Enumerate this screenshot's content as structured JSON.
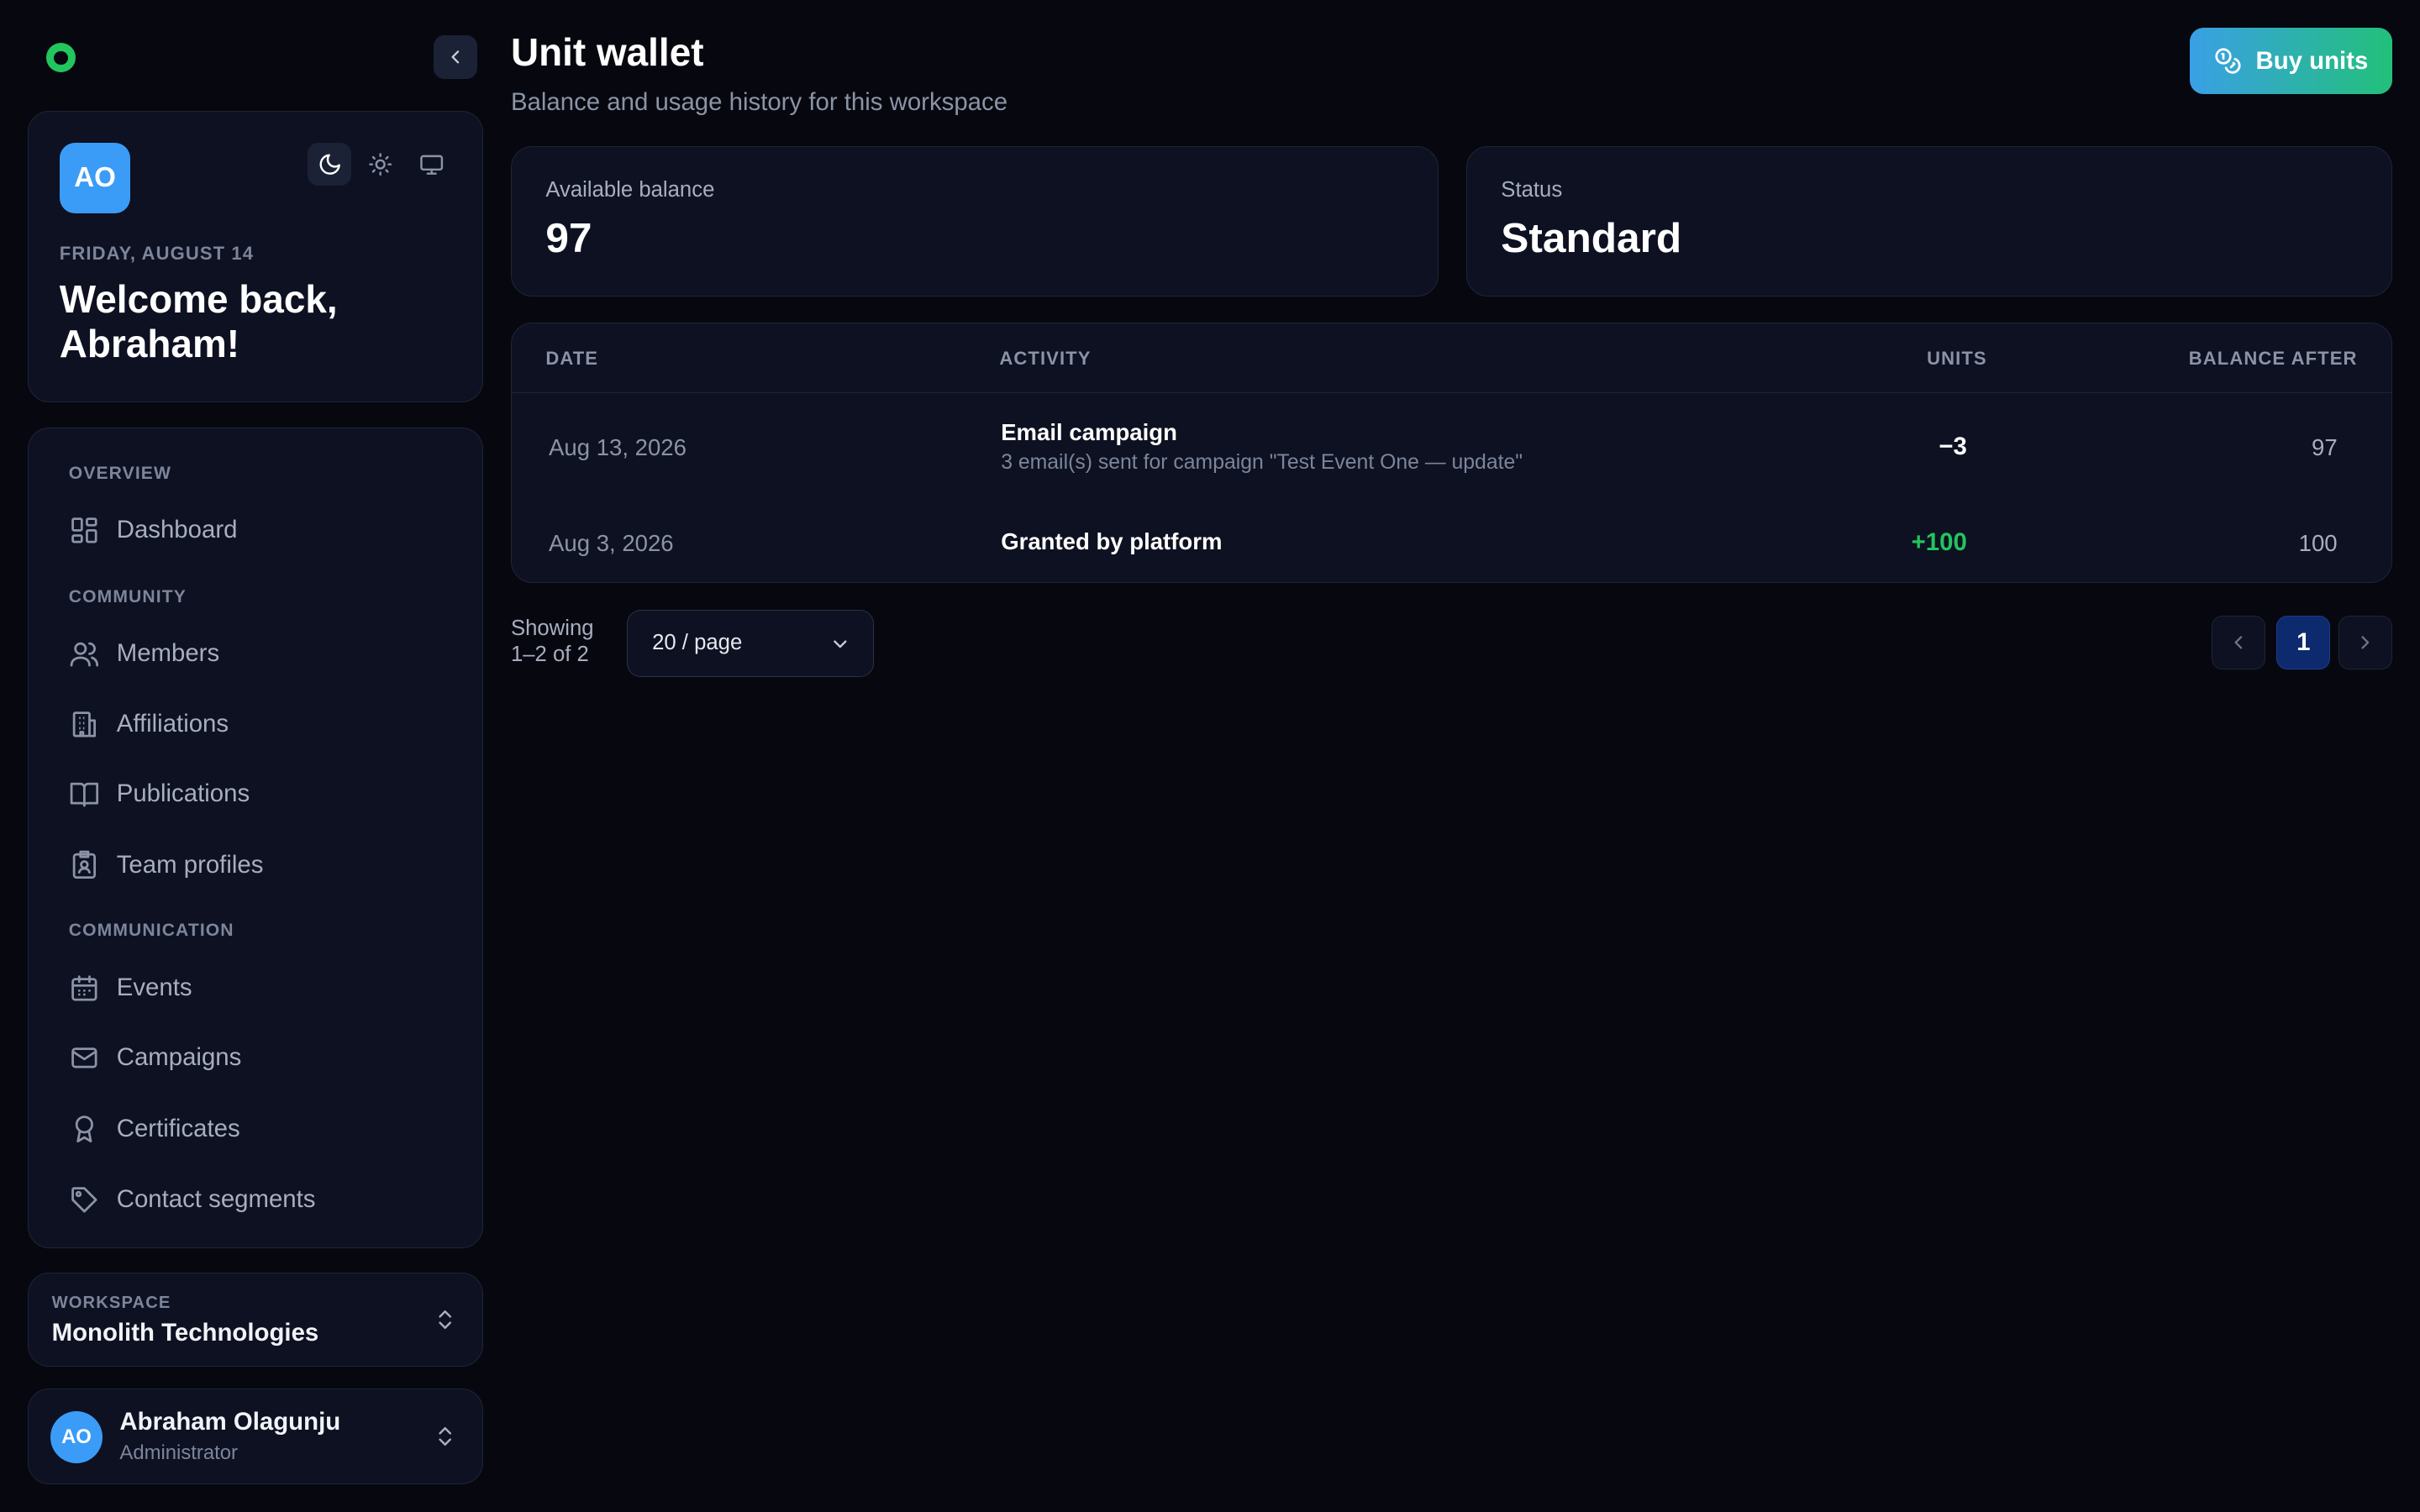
{
  "sidebar": {
    "welcome": {
      "avatar_initials": "AO",
      "date": "FRIDAY, AUGUST 14",
      "title": "Welcome back, Abraham!",
      "theme_options": [
        "dark",
        "light",
        "system"
      ],
      "active_theme": "dark"
    },
    "nav": {
      "sections": [
        {
          "label": "OVERVIEW",
          "items": [
            {
              "label": "Dashboard",
              "icon": "dashboard-icon"
            }
          ]
        },
        {
          "label": "COMMUNITY",
          "items": [
            {
              "label": "Members",
              "icon": "members-icon"
            },
            {
              "label": "Affiliations",
              "icon": "building-icon"
            },
            {
              "label": "Publications",
              "icon": "book-icon"
            },
            {
              "label": "Team profiles",
              "icon": "id-badge-icon"
            }
          ]
        },
        {
          "label": "COMMUNICATION",
          "items": [
            {
              "label": "Events",
              "icon": "calendar-icon"
            },
            {
              "label": "Campaigns",
              "icon": "mail-icon"
            },
            {
              "label": "Certificates",
              "icon": "award-icon"
            },
            {
              "label": "Contact segments",
              "icon": "tag-icon"
            }
          ]
        }
      ]
    },
    "workspace": {
      "caption": "WORKSPACE",
      "name": "Monolith Technologies"
    },
    "user": {
      "initials": "AO",
      "name": "Abraham Olagunju",
      "role": "Administrator"
    }
  },
  "header": {
    "title": "Unit wallet",
    "subtitle": "Balance and usage history for this workspace",
    "buy_label": "Buy units"
  },
  "stats": {
    "balance": {
      "label": "Available balance",
      "value": "97"
    },
    "status": {
      "label": "Status",
      "value": "Standard"
    }
  },
  "table": {
    "columns": [
      "DATE",
      "ACTIVITY",
      "UNITS",
      "BALANCE AFTER"
    ],
    "rows": [
      {
        "date": "Aug 13, 2026",
        "activity": "Email campaign",
        "detail": "3 email(s) sent for campaign \"Test Event One — update\"",
        "units": "−3",
        "balance": "97"
      },
      {
        "date": "Aug 3, 2026",
        "activity": "Granted by platform",
        "detail": "",
        "units": "+100",
        "balance": "100"
      }
    ]
  },
  "pagination": {
    "showing": "Showing",
    "range": "1–2 of 2",
    "page_size": "20 / page",
    "current_page": "1"
  },
  "colors": {
    "background": "#07080f",
    "card": "#0d1121",
    "accent_blue": "#3b9cf7",
    "positive": "#22c55e",
    "page_active": "#0e2a6e"
  }
}
